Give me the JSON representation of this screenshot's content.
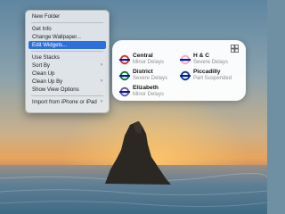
{
  "menu": {
    "items": [
      {
        "label": "New Folder"
      },
      {
        "label": "Get Info"
      },
      {
        "label": "Change Wallpaper..."
      },
      {
        "label": "Edit Widgets..."
      },
      {
        "label": "Use Stacks"
      },
      {
        "label": "Sort By"
      },
      {
        "label": "Clean Up"
      },
      {
        "label": "Clean Up By"
      },
      {
        "label": "Show View Options"
      },
      {
        "label": "Import from iPhone or iPad"
      }
    ]
  },
  "widget": {
    "lines": [
      {
        "name": "Central",
        "status": "Minor Delays",
        "color": "#dc241f"
      },
      {
        "name": "H & C",
        "status": "Severe Delays",
        "color": "#f3a9bb"
      },
      {
        "name": "District",
        "status": "Severe Delays",
        "color": "#00782a"
      },
      {
        "name": "Piccadilly",
        "status": "Part Suspended",
        "color": "#003688"
      },
      {
        "name": "Elizabeth",
        "status": "Minor Delays",
        "color": "#6950a1"
      }
    ],
    "corner_icon": "grid-icon"
  },
  "colors": {
    "menu_highlight": "#2f6fdc",
    "status_gray": "#8e8e93"
  }
}
